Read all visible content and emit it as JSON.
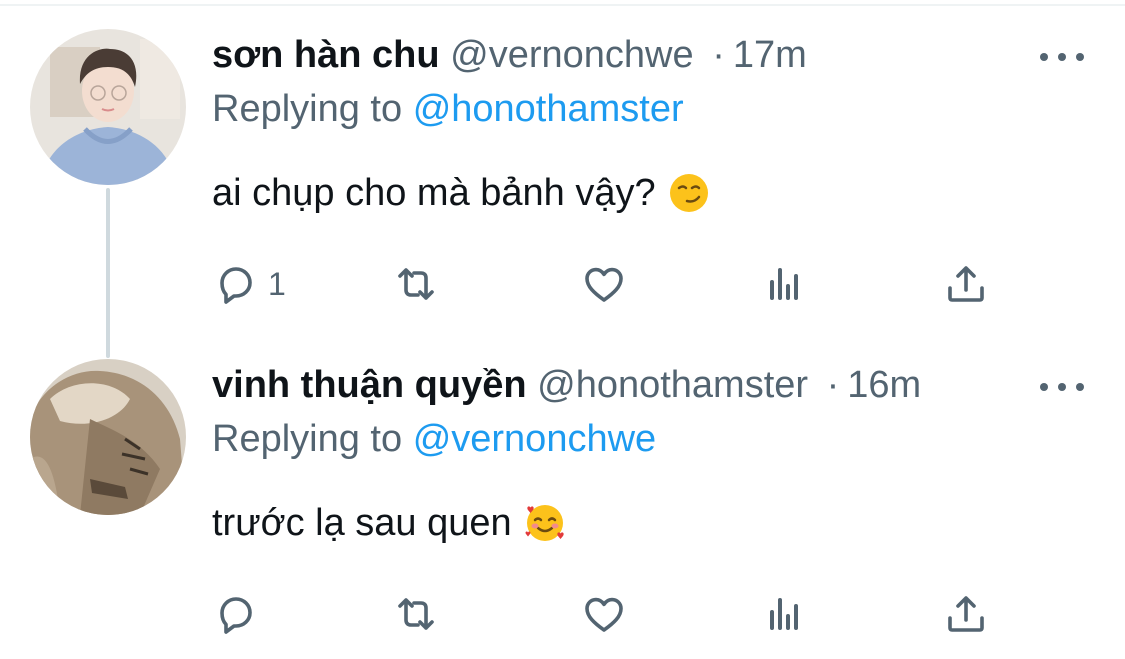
{
  "tweets": [
    {
      "display_name": "sơn hàn chu",
      "handle": "@vernonchwe",
      "time": "17m",
      "replying_prefix": "Replying to",
      "replying_to": "@honothamster",
      "text": "ai chụp cho mà bảnh vậy?",
      "emoji": "smirking-face",
      "reply_count": "1",
      "avatar_desc": "avatar-hoodie-blue"
    },
    {
      "display_name": "vinh thuận quyền",
      "handle": "@honothamster",
      "time": "16m",
      "replying_prefix": "Replying to",
      "replying_to": "@vernonchwe",
      "text": "trước lạ sau quen",
      "emoji": "smiling-face-with-hearts",
      "reply_count": "",
      "avatar_desc": "avatar-hoodie-tan"
    }
  ],
  "separator": "·",
  "colors": {
    "primary_text": "#0f1419",
    "secondary_text": "#536471",
    "link": "#1d9bf0",
    "thread_line": "#cfd9de"
  },
  "icons": [
    "reply-icon",
    "retweet-icon",
    "like-icon",
    "views-icon",
    "share-icon",
    "more-icon"
  ]
}
